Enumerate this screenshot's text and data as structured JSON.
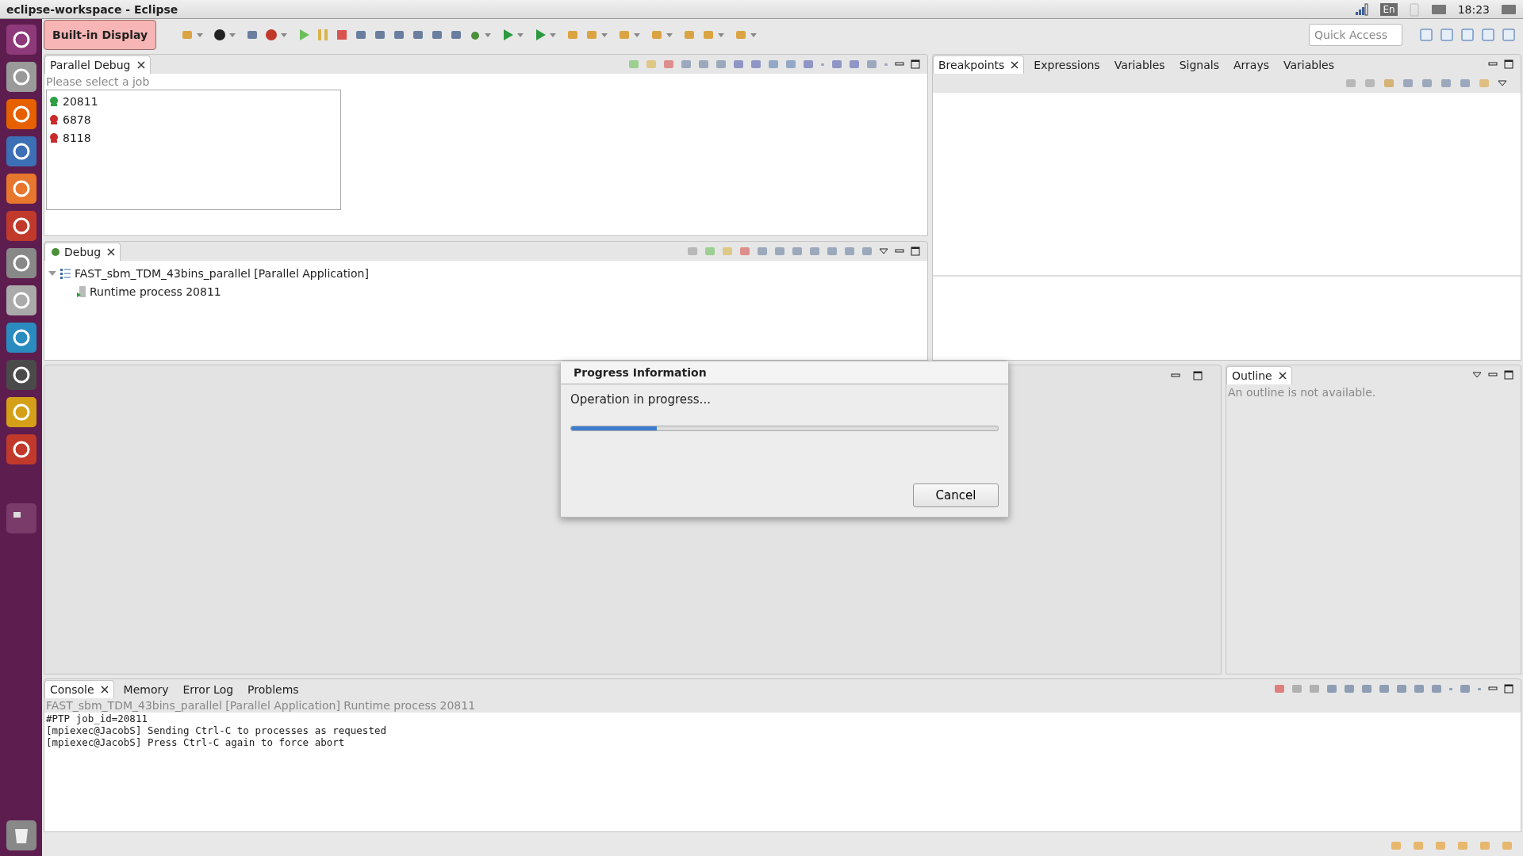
{
  "window": {
    "title": "eclipse-workspace - Eclipse"
  },
  "system_tray": {
    "keyboard": "En",
    "time": "18:23"
  },
  "tooltip": "Built-in Display",
  "quick_access": {
    "placeholder": "Quick Access"
  },
  "parallel_debug": {
    "tab": {
      "label": "Parallel Debug",
      "selected": true
    },
    "hint": "Please select a job",
    "jobs": [
      {
        "id": "20811",
        "color": "#2f9e44"
      },
      {
        "id": "6878",
        "color": "#c92a2a"
      },
      {
        "id": "8118",
        "color": "#c92a2a"
      }
    ]
  },
  "debug": {
    "tab": {
      "label": "Debug",
      "selected": true
    },
    "tree": [
      {
        "label": "FAST_sbm_TDM_43bins_parallel [Parallel Application]",
        "expanded": true,
        "children": [
          {
            "label": "Runtime process 20811"
          }
        ]
      }
    ]
  },
  "right_tabs": [
    {
      "label": "Breakpoints",
      "selected": true
    },
    {
      "label": "Expressions",
      "selected": false
    },
    {
      "label": "Variables",
      "selected": false
    },
    {
      "label": "Signals",
      "selected": false
    },
    {
      "label": "Arrays",
      "selected": false
    },
    {
      "label": "Variables",
      "selected": false
    }
  ],
  "outline": {
    "tab": {
      "label": "Outline",
      "selected": true
    },
    "message": "An outline is not available."
  },
  "console": {
    "tabs": [
      {
        "label": "Console",
        "selected": true
      },
      {
        "label": "Memory",
        "selected": false
      },
      {
        "label": "Error Log",
        "selected": false
      },
      {
        "label": "Problems",
        "selected": false
      }
    ],
    "description": "FAST_sbm_TDM_43bins_parallel [Parallel Application] Runtime process 20811",
    "lines": [
      "#PTP job_id=20811",
      "[mpiexec@JacobS] Sending Ctrl-C to processes as requested",
      "[mpiexec@JacobS] Press Ctrl-C again to force abort"
    ]
  },
  "dialog": {
    "title": "Progress Information",
    "message": "Operation in progress...",
    "level": 0.2,
    "buttons": [
      "Cancel"
    ]
  }
}
